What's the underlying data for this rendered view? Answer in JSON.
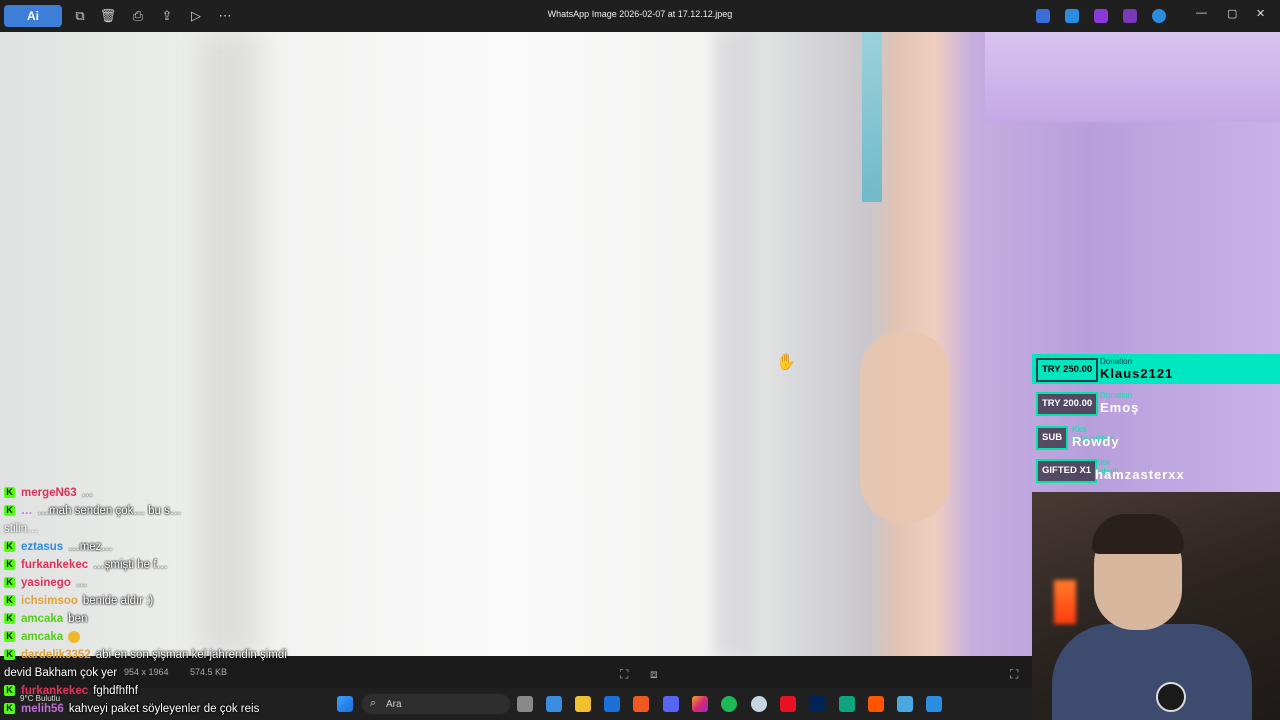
{
  "viewer": {
    "logo": "Ai",
    "file_title": "WhatsApp Image 2026-02-07 at 17.12.12.jpeg",
    "toolbar": [
      "copy-icon",
      "delete-icon",
      "print-icon",
      "share-icon",
      "slideshow-icon",
      "more-icon"
    ],
    "dimensions": "954 x 1964",
    "file_size": "574.5 KB",
    "window_controls": [
      "minimize",
      "maximize",
      "close"
    ]
  },
  "chat": {
    "messages": [
      {
        "user": "mergeN63",
        "color": "#e0315a",
        "text": "…"
      },
      {
        "user": "…",
        "color": "#c06cd8",
        "text": "…mah senden çok… bu s…",
        "cont": "stilin… "
      },
      {
        "user": "eztasus",
        "color": "#2e8be0",
        "text": "…mez…"
      },
      {
        "user": "furkankekec",
        "color": "#e0315a",
        "text": "…şmişti he f…"
      },
      {
        "user": "yasinego",
        "color": "#e0315a",
        "text": "…"
      },
      {
        "user": "ichsimsoo",
        "color": "#e0a13a",
        "text": "benide aldır :)"
      },
      {
        "user": "amcaka",
        "color": "#53d018",
        "text": "ben"
      },
      {
        "user": "amcaka",
        "color": "#53d018",
        "text": "",
        "emoji": true
      },
      {
        "user": "dardelik3352",
        "color": "#e0a13a",
        "text": "abi en son şişman kel jahrendin şimdi",
        "cont": "devid Bakham çok yer"
      },
      {
        "user": "furkankekec",
        "color": "#e0315a",
        "text": "fghdfhfhf"
      },
      {
        "user": "melih56",
        "color": "#c06cd8",
        "text": "kahveyi paket söyleyenler de çok reis"
      }
    ]
  },
  "alerts": [
    {
      "amount": "TRY 250.00",
      "type": "Donation",
      "name": "Klaus2121",
      "active": true
    },
    {
      "amount": "TRY 200.00",
      "type": "Donation",
      "name": "Emoş",
      "active": false
    },
    {
      "amount": "SUB",
      "type": "Kick subscription",
      "name": "Rowdy",
      "active": false
    },
    {
      "amount": "GIFTED X1",
      "type": "Kick subgift",
      "name": "hamzasterxx",
      "active": false
    }
  ],
  "taskbar": {
    "search_placeholder": "Ara",
    "weather": "9°C Bulutlu",
    "apps": [
      "start-icon",
      "widgets-icon",
      "task-view-icon",
      "store-icon",
      "explorer-icon",
      "outlook-icon",
      "brave-icon",
      "discord-icon",
      "instagram-icon",
      "spotify-icon",
      "steam-icon",
      "xbox-icon",
      "powershell-icon",
      "chatgpt-icon",
      "soundcloud-icon",
      "notepad-icon",
      "photos-icon"
    ]
  },
  "colors": {
    "kick_green": "#53fc18",
    "alert_accent": "#00e6a8"
  }
}
